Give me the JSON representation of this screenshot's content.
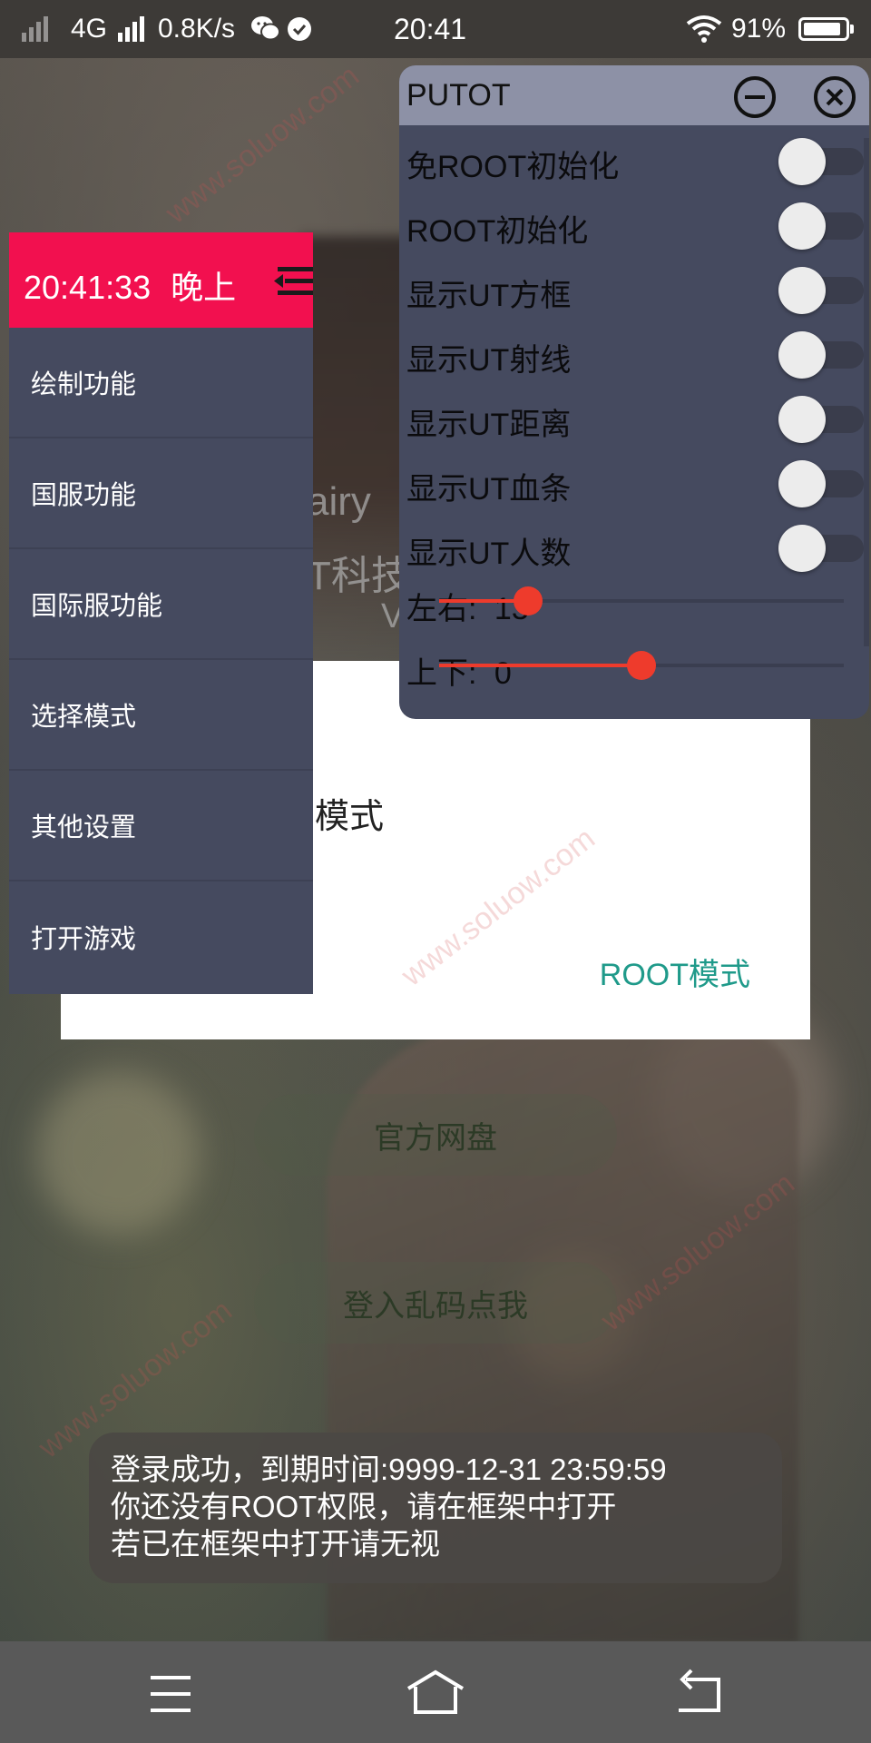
{
  "status_bar": {
    "network": "4G",
    "speed": "0.8K/s",
    "time": "20:41",
    "battery": "91%",
    "battery_level": 0.91
  },
  "background": {
    "text_line1": "airy",
    "text_line2": "T科技",
    "text_line3": "V"
  },
  "dialog": {
    "title": "模式",
    "root_button": "ROOT模式"
  },
  "bg_buttons": {
    "pan": "官方网盘",
    "login_fix": "登入乱码点我"
  },
  "side_menu": {
    "time": "20:41:33",
    "period": "晚上",
    "items": [
      "绘制功能",
      "国服功能",
      "国际服功能",
      "选择模式",
      "其他设置",
      "打开游戏"
    ]
  },
  "panel": {
    "title": "PUTOT",
    "options": [
      {
        "label": "免ROOT初始化",
        "on": false
      },
      {
        "label": "ROOT初始化",
        "on": false
      },
      {
        "label": "显示UT方框",
        "on": false
      },
      {
        "label": "显示UT射线",
        "on": false
      },
      {
        "label": "显示UT距离",
        "on": false
      },
      {
        "label": "显示UT血条",
        "on": false
      },
      {
        "label": "显示UT人数",
        "on": false
      }
    ],
    "sliders": [
      {
        "label": "左右:",
        "value": "13",
        "fraction": 0.22
      },
      {
        "label": "上下:",
        "value": "0",
        "fraction": 0.5
      }
    ]
  },
  "toast": {
    "line1": "登录成功，到期时间:9999-12-31 23:59:59",
    "line2": "你还没有ROOT权限，请在框架中打开",
    "line3": "若已在框架中打开请无视"
  },
  "colors": {
    "menu_header": "#f2104f",
    "panel_bg": "#454a5f",
    "slider_accent": "#ee3b2c",
    "dialog_button": "#1f9a8a"
  },
  "icons": {
    "minimize": "minus-circle-icon",
    "close": "close-circle-icon",
    "collapse": "menu-collapse-icon",
    "nav_menu": "menu-icon",
    "nav_home": "home-icon",
    "nav_back": "back-icon"
  }
}
